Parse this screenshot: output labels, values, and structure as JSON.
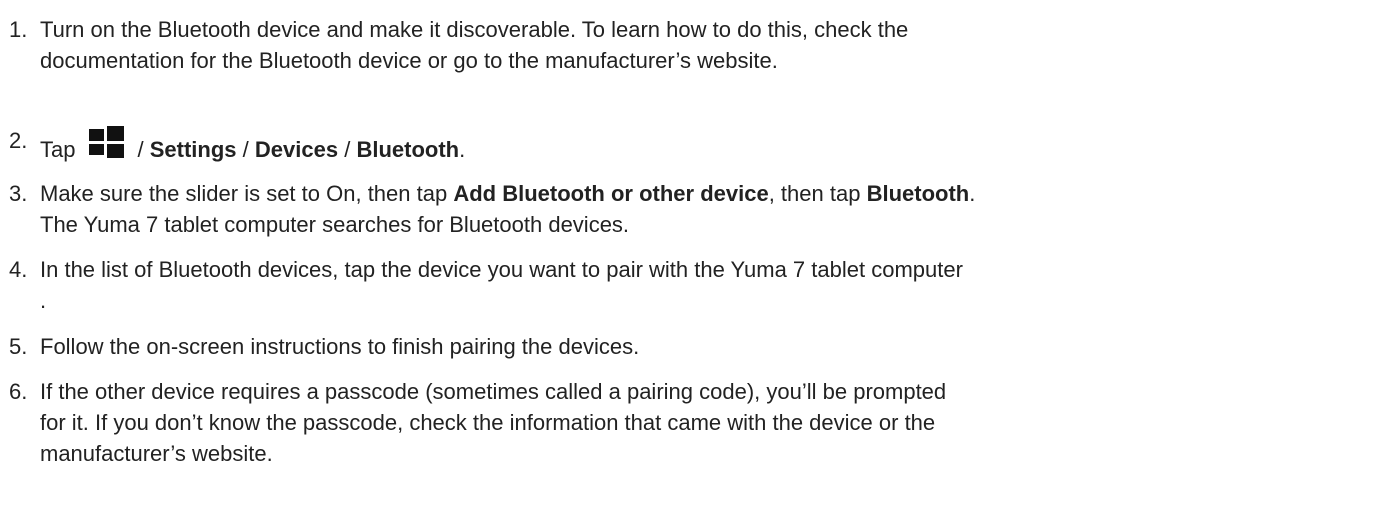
{
  "steps": [
    {
      "number": "1.",
      "lines": [
        "Turn on the Bluetooth device and make it discoverable. To learn how to do this, check the",
        "documentation for the Bluetooth device or go to the manufacturer’s website."
      ]
    },
    {
      "number": "2.",
      "tap": "Tap",
      "icon": "windows-start-icon",
      "sep1": "/",
      "settings": "Settings",
      "sep2": "/",
      "devices": "Devices",
      "sep3": "/",
      "bluetooth": "Bluetooth",
      "end": "."
    },
    {
      "number": "3.",
      "line1_a": "Make sure the slider is set to On, then tap",
      "line1_b": "Add Bluetooth or other device",
      "line1_c": ", then tap",
      "line1_d": "Bluetooth",
      "line1_e": ".",
      "line2": "The Yuma 7 tablet computer searches for Bluetooth devices."
    },
    {
      "number": "4.",
      "lines": [
        "In the list of Bluetooth devices, tap the device you want to pair with the Yuma 7 tablet computer",
        "."
      ]
    },
    {
      "number": "5.",
      "lines": [
        "Follow the on-screen instructions to finish pairing the devices."
      ]
    },
    {
      "number": "6.",
      "lines": [
        "If the other device requires a passcode (sometimes called a pairing code), you’ll be prompted",
        "for it. If you don’t know the passcode, check the information that came with the device or the",
        "manufacturer’s website."
      ]
    }
  ]
}
